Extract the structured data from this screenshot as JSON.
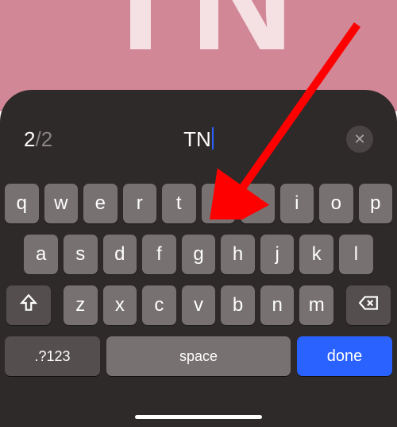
{
  "wallpaper": {
    "partial_text": "TN"
  },
  "input": {
    "counter_current": "2",
    "counter_sep": "/",
    "counter_max": "2",
    "value": "TN"
  },
  "close": {
    "glyph": "✕"
  },
  "keyboard": {
    "row1": [
      "q",
      "w",
      "e",
      "r",
      "t",
      "y",
      "u",
      "i",
      "o",
      "p"
    ],
    "row2": [
      "a",
      "s",
      "d",
      "f",
      "g",
      "h",
      "j",
      "k",
      "l"
    ],
    "row3": [
      "z",
      "x",
      "c",
      "v",
      "b",
      "n",
      "m"
    ],
    "numbers_label": ".?123",
    "space_label": "space",
    "done_label": "done"
  }
}
